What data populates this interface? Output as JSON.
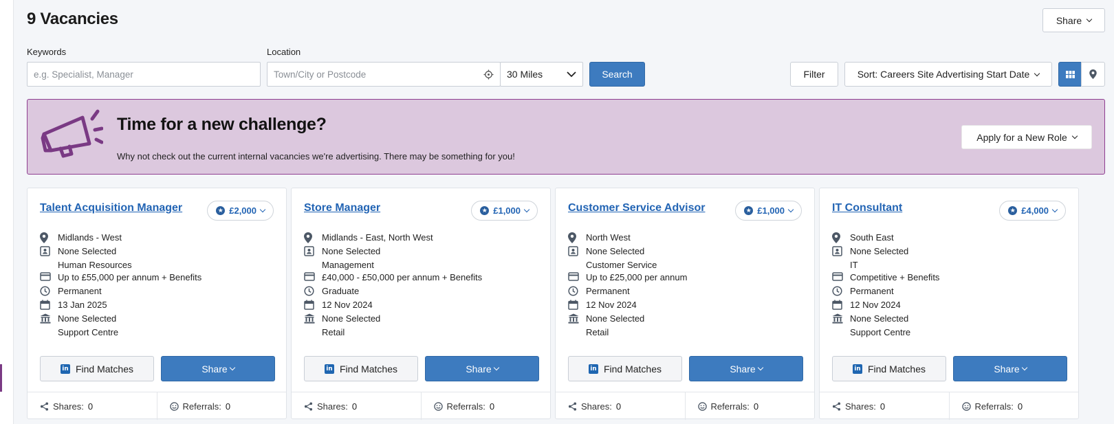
{
  "header": {
    "title": "9 Vacancies",
    "share_label": "Share"
  },
  "search": {
    "keywords_label": "Keywords",
    "keywords_placeholder": "e.g. Specialist, Manager",
    "location_label": "Location",
    "location_placeholder": "Town/City or Postcode",
    "radius_value": "30 Miles",
    "search_label": "Search",
    "filter_label": "Filter",
    "sort_label": "Sort: Careers Site Advertising Start Date"
  },
  "banner": {
    "title": "Time for a new challenge?",
    "subtitle": "Why not check out the current internal vacancies we're advertising. There may be something for you!",
    "apply_label": "Apply for a New Role"
  },
  "card_labels": {
    "find_matches": "Find Matches",
    "share": "Share",
    "shares_label": "Shares:",
    "referrals_label": "Referrals:"
  },
  "vacancies": [
    {
      "title": "Talent Acquisition Manager",
      "bonus": "£2,000",
      "location": "Midlands - West",
      "contact": "None Selected",
      "department": "Human Resources",
      "salary": "Up to £55,000 per annum + Benefits",
      "type": "Permanent",
      "date": "13 Jan 2025",
      "org": "None Selected",
      "org_sub": "Support Centre",
      "shares": "0",
      "referrals": "0"
    },
    {
      "title": "Store Manager",
      "bonus": "£1,000",
      "location": "Midlands - East, North West",
      "contact": "None Selected",
      "department": "Management",
      "salary": "£40,000 - £50,000 per annum + Benefits",
      "type": "Graduate",
      "date": "12 Nov 2024",
      "org": "None Selected",
      "org_sub": "Retail",
      "shares": "0",
      "referrals": "0"
    },
    {
      "title": "Customer Service Advisor",
      "bonus": "£1,000",
      "location": "North West",
      "contact": "None Selected",
      "department": "Customer Service",
      "salary": "Up to £25,000 per annum",
      "type": "Permanent",
      "date": "12 Nov 2024",
      "org": "None Selected",
      "org_sub": "Retail",
      "shares": "0",
      "referrals": "0"
    },
    {
      "title": "IT Consultant",
      "bonus": "£4,000",
      "location": "South East",
      "contact": "None Selected",
      "department": "IT",
      "salary": "Competitive + Benefits",
      "type": "Permanent",
      "date": "12 Nov 2024",
      "org": "None Selected",
      "org_sub": "Support Centre",
      "shares": "0",
      "referrals": "0"
    }
  ],
  "icons": {
    "location": "map-pin-icon",
    "contact": "contact-card-icon",
    "salary": "credit-card-icon",
    "type": "clock-icon",
    "date": "calendar-icon",
    "org": "bank-building-icon",
    "shares": "share-nodes-icon",
    "referrals": "smiley-icon"
  },
  "colors": {
    "primary": "#3d7bbf",
    "link": "#2264b4",
    "banner_bg": "#dcc8de",
    "banner_border": "#8e3d90",
    "megaphone": "#7a3a84"
  }
}
